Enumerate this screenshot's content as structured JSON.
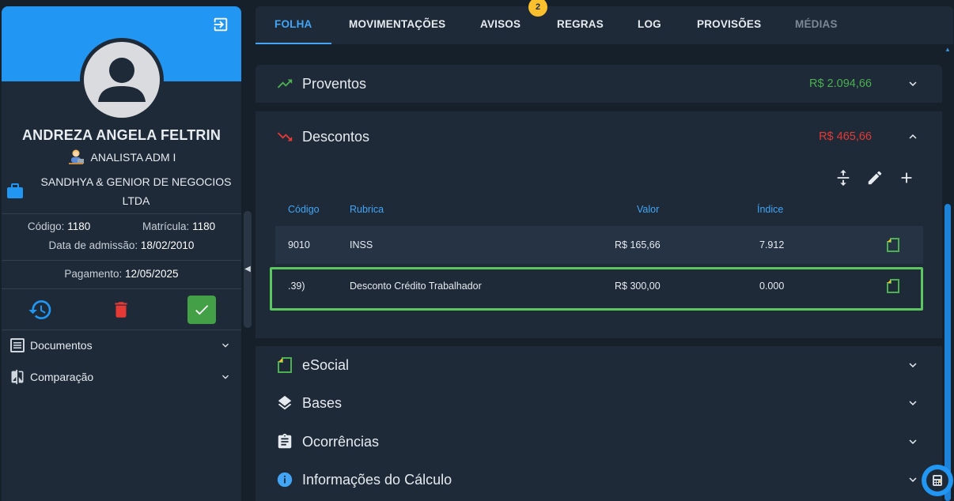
{
  "employee": {
    "name": "ANDREZA ANGELA FELTRIN",
    "role": "ANALISTA ADM I",
    "company": "SANDHYA & GENIOR DE NEGOCIOS LTDA",
    "codigo_label": "Código:",
    "codigo": "1180",
    "matricula_label": "Matrícula:",
    "matricula": "1180",
    "admissao_label": "Data de admissão:",
    "admissao": "18/02/2010",
    "pagamento_label": "Pagamento:",
    "pagamento": "12/05/2025"
  },
  "sidebar_menu": [
    {
      "label": "Documentos",
      "icon": "document-list-icon"
    },
    {
      "label": "Comparação",
      "icon": "compare-icon"
    }
  ],
  "tabs": [
    {
      "label": "FOLHA",
      "state": "active"
    },
    {
      "label": "MOVIMENTAÇÕES",
      "state": "normal"
    },
    {
      "label": "AVISOS",
      "state": "normal",
      "badge": "2"
    },
    {
      "label": "REGRAS",
      "state": "normal"
    },
    {
      "label": "LOG",
      "state": "normal"
    },
    {
      "label": "PROVISÕES",
      "state": "normal"
    },
    {
      "label": "MÉDIAS",
      "state": "disabled"
    }
  ],
  "sections": {
    "proventos": {
      "title": "Proventos",
      "amount": "R$ 2.094,66",
      "color": "#4caf50"
    },
    "descontos": {
      "title": "Descontos",
      "amount": "R$ 465,66",
      "color": "#e53935"
    },
    "esocial": {
      "title": "eSocial"
    },
    "bases": {
      "title": "Bases"
    },
    "ocorrencias": {
      "title": "Ocorrências"
    },
    "informacoes": {
      "title": "Informações do Cálculo"
    }
  },
  "table": {
    "headers": {
      "codigo": "Código",
      "rubrica": "Rubrica",
      "valor": "Valor",
      "indice": "Índice"
    },
    "rows": [
      {
        "codigo": "9010",
        "rubrica": "INSS",
        "valor": "R$ 165,66",
        "indice": "7.912"
      },
      {
        "codigo": ".39)",
        "rubrica": "Desconto Crédito Trabalhador",
        "valor": "R$ 300,00",
        "indice": "0.000"
      }
    ]
  },
  "colors": {
    "accent": "#2196f3",
    "success": "#43a047",
    "danger": "#e53935",
    "highlight": "#5cc75f",
    "warning": "#fbc02d"
  }
}
